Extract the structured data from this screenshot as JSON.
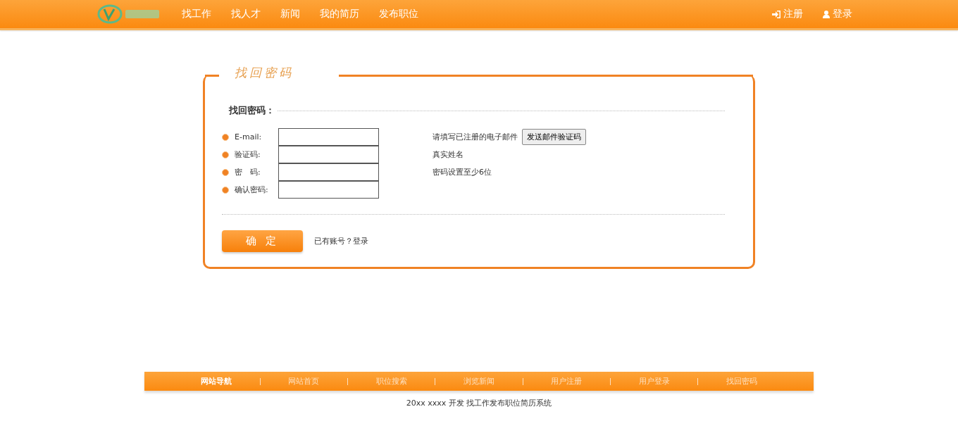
{
  "nav": {
    "items": [
      {
        "label": "找工作"
      },
      {
        "label": "找人才"
      },
      {
        "label": "新闻"
      },
      {
        "label": "我的简历"
      },
      {
        "label": "发布职位"
      }
    ],
    "actions": [
      {
        "kind": "register",
        "label": "注册"
      },
      {
        "kind": "login",
        "label": "登录"
      }
    ]
  },
  "panel": {
    "title": "找回密码",
    "section": "找回密码：",
    "fields": [
      {
        "label": "E-mail:",
        "hint": "请填写已注册的电子邮件",
        "button": "发送邮件验证码"
      },
      {
        "label": "验证码:",
        "hint": "真实姓名"
      },
      {
        "label": "密　码:",
        "hint": "密码设置至少6位"
      },
      {
        "label": "确认密码:"
      }
    ],
    "submit": "确 定",
    "login_prompt": "已有账号？登录"
  },
  "footer": {
    "nav": [
      {
        "label": "网站导航",
        "kind": "heading"
      },
      {
        "label": "网站首页",
        "kind": "link"
      },
      {
        "label": "职位搜索",
        "kind": "link"
      },
      {
        "label": "浏览新闻",
        "kind": "link"
      },
      {
        "label": "用户注册",
        "kind": "link"
      },
      {
        "label": "用户登录",
        "kind": "link"
      },
      {
        "label": "找回密码",
        "kind": "link"
      }
    ],
    "copyright": "20xx xxxx 开发 找工作发布职位简历系统"
  }
}
